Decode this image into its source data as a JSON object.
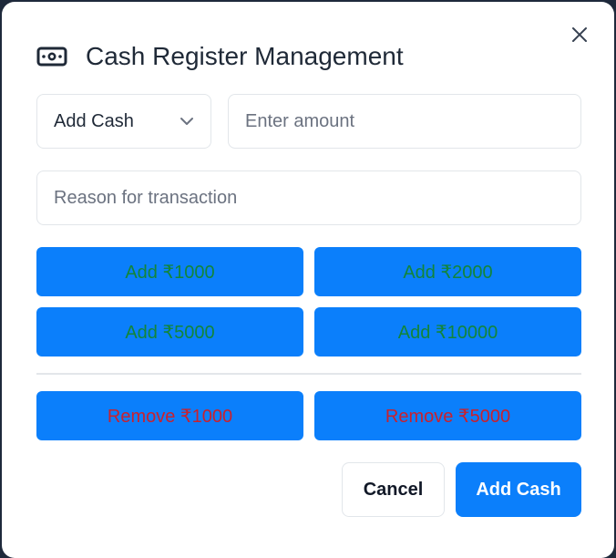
{
  "dialog": {
    "title": "Cash Register Management",
    "title_icon": "cash-icon",
    "close_icon": "close-icon"
  },
  "form": {
    "type_select": {
      "value": "Add Cash",
      "icon": "chevron-down-icon"
    },
    "amount": {
      "placeholder": "Enter amount",
      "value": ""
    },
    "reason": {
      "placeholder": "Reason for transaction",
      "value": ""
    }
  },
  "quick_add": [
    {
      "label": "Add ₹1000"
    },
    {
      "label": "Add ₹2000"
    },
    {
      "label": "Add ₹5000"
    },
    {
      "label": "Add ₹10000"
    }
  ],
  "quick_remove": [
    {
      "label": "Remove ₹1000"
    },
    {
      "label": "Remove ₹5000"
    }
  ],
  "actions": {
    "cancel_label": "Cancel",
    "submit_label": "Add Cash"
  },
  "colors": {
    "primary": "#0b7ffb",
    "add_text": "#12853a",
    "remove_text": "#c9212d"
  }
}
